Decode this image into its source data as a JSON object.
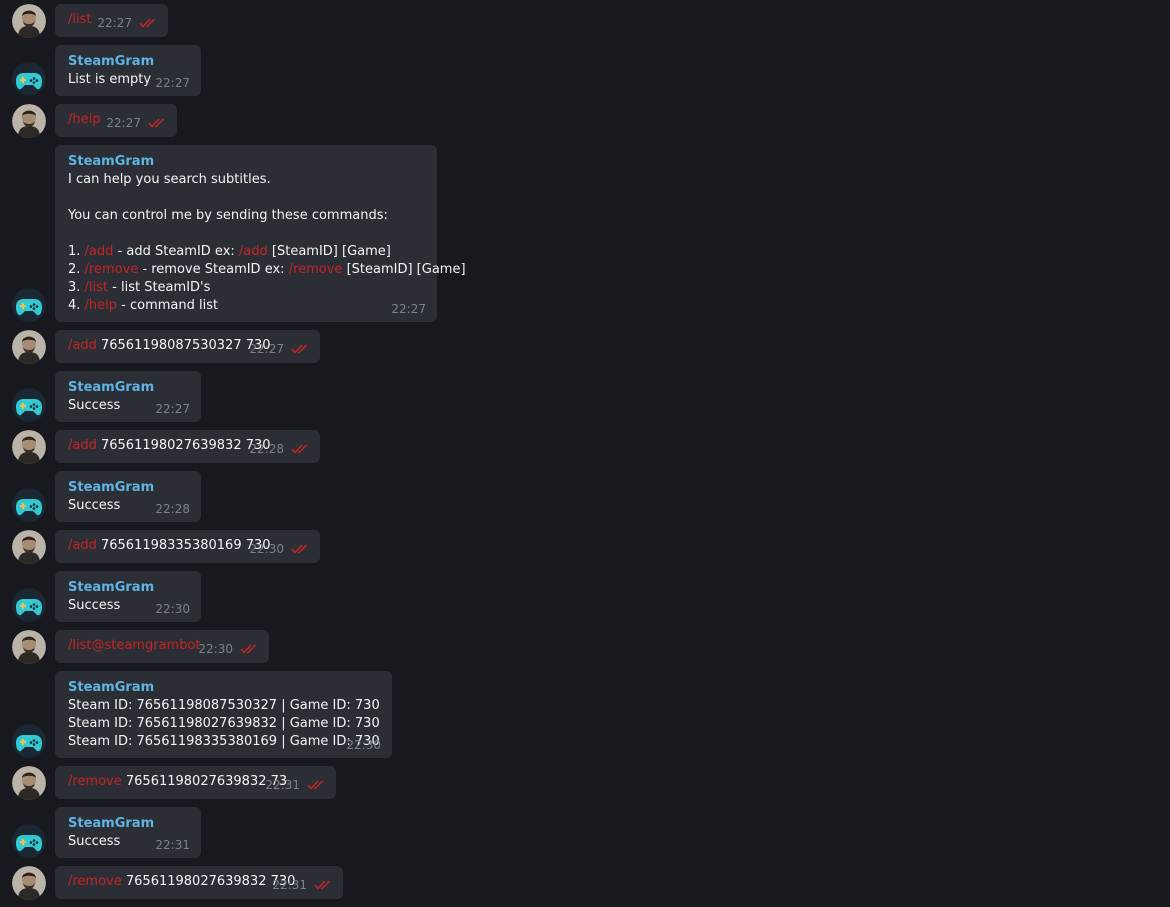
{
  "bot": {
    "name": "SteamGram"
  },
  "messages": [
    {
      "id": "m1",
      "from": "user",
      "parts": [
        {
          "t": "/list",
          "cmd": true
        }
      ],
      "time": "22:27"
    },
    {
      "id": "m2",
      "from": "bot",
      "lines": [
        [
          {
            "t": "List is empty"
          }
        ]
      ],
      "time": "22:27"
    },
    {
      "id": "m3",
      "from": "user",
      "parts": [
        {
          "t": "/help",
          "cmd": true
        }
      ],
      "time": "22:27"
    },
    {
      "id": "m4",
      "from": "bot",
      "lines": [
        [
          {
            "t": "I can help you search subtitles."
          }
        ],
        [],
        [
          {
            "t": "You can control me by sending these commands:"
          }
        ],
        [],
        [
          {
            "t": "1. "
          },
          {
            "t": "/add",
            "cmd": true
          },
          {
            "t": " - add SteamID ex: "
          },
          {
            "t": "/add",
            "cmd": true
          },
          {
            "t": " [SteamID] [Game]"
          }
        ],
        [
          {
            "t": "2. "
          },
          {
            "t": "/remove",
            "cmd": true
          },
          {
            "t": " - remove SteamID ex: "
          },
          {
            "t": "/remove",
            "cmd": true
          },
          {
            "t": " [SteamID] [Game]"
          }
        ],
        [
          {
            "t": "3. "
          },
          {
            "t": "/list",
            "cmd": true
          },
          {
            "t": " - list SteamID's"
          }
        ],
        [
          {
            "t": "4. "
          },
          {
            "t": "/help",
            "cmd": true
          },
          {
            "t": " - command list"
          }
        ]
      ],
      "time": "22:27"
    },
    {
      "id": "m5",
      "from": "user",
      "parts": [
        {
          "t": "/add",
          "cmd": true
        },
        {
          "t": " 76561198087530327 730"
        }
      ],
      "time": "22:27"
    },
    {
      "id": "m6",
      "from": "bot",
      "lines": [
        [
          {
            "t": "Success"
          }
        ]
      ],
      "time": "22:27"
    },
    {
      "id": "m7",
      "from": "user",
      "parts": [
        {
          "t": "/add",
          "cmd": true
        },
        {
          "t": " 76561198027639832 730"
        }
      ],
      "time": "22:28"
    },
    {
      "id": "m8",
      "from": "bot",
      "lines": [
        [
          {
            "t": "Success"
          }
        ]
      ],
      "time": "22:28"
    },
    {
      "id": "m9",
      "from": "user",
      "parts": [
        {
          "t": "/add",
          "cmd": true
        },
        {
          "t": " 76561198335380169 730"
        }
      ],
      "time": "22:30"
    },
    {
      "id": "m10",
      "from": "bot",
      "lines": [
        [
          {
            "t": "Success"
          }
        ]
      ],
      "time": "22:30"
    },
    {
      "id": "m11",
      "from": "user",
      "parts": [
        {
          "t": "/list@steamgrambot",
          "cmd": true
        }
      ],
      "time": "22:30"
    },
    {
      "id": "m12",
      "from": "bot",
      "lines": [
        [
          {
            "t": "Steam ID: 76561198087530327 | Game ID: 730"
          }
        ],
        [
          {
            "t": "Steam ID: 76561198027639832 | Game ID: 730"
          }
        ],
        [
          {
            "t": "Steam ID: 76561198335380169 | Game ID: 730"
          }
        ]
      ],
      "time": "22:30"
    },
    {
      "id": "m13",
      "from": "user",
      "parts": [
        {
          "t": "/remove",
          "cmd": true
        },
        {
          "t": " 76561198027639832 73"
        }
      ],
      "time": "22:31"
    },
    {
      "id": "m14",
      "from": "bot",
      "lines": [
        [
          {
            "t": "Success"
          }
        ]
      ],
      "time": "22:31"
    },
    {
      "id": "m15",
      "from": "user",
      "parts": [
        {
          "t": "/remove",
          "cmd": true
        },
        {
          "t": " 76561198027639832 730"
        }
      ],
      "time": "22:31"
    }
  ],
  "colors": {
    "background": "#17191e",
    "bubble": "#2b2f35",
    "command": "#c62323",
    "sender": "#5fb4e4",
    "time": "#7b828a",
    "read_check": "#c62323"
  }
}
